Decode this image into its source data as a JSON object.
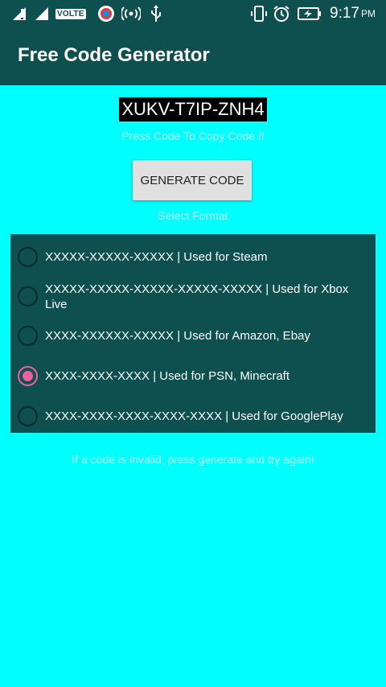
{
  "status_bar": {
    "network_label": "VOLTE",
    "time": "9:17",
    "ampm": "PM",
    "icons": [
      "signal-icon",
      "signal-icon",
      "volte-badge",
      "app-notification-icon",
      "hotspot-icon",
      "usb-icon",
      "vibrate-icon",
      "alarm-icon",
      "battery-charging-icon"
    ]
  },
  "app_bar": {
    "title": "Free Code Generator",
    "background": "#0E4F4F"
  },
  "main": {
    "code": "XUKV-T7IP-ZNH4",
    "copy_hint": "Press Code To Copy Code !!",
    "generate_label": "GENERATE CODE",
    "select_format_label": "Select Format",
    "footer_hint": "If a code is invalid, press generate and try again!",
    "background": "#00FFFF"
  },
  "formats": {
    "options": [
      {
        "label": "XXXXX-XXXXX-XXXXX | Used for Steam",
        "checked": false
      },
      {
        "label": "XXXXX-XXXXX-XXXXX-XXXXX-XXXXX | Used for Xbox Live",
        "checked": false
      },
      {
        "label": "XXXX-XXXXXX-XXXXX | Used for Amazon, Ebay",
        "checked": false
      },
      {
        "label": "XXXX-XXXX-XXXX | Used for PSN, Minecraft",
        "checked": true
      },
      {
        "label": "XXXX-XXXX-XXXX-XXXX-XXXX | Used for GooglePlay",
        "checked": false
      }
    ],
    "accent": "#EC5F9A"
  }
}
